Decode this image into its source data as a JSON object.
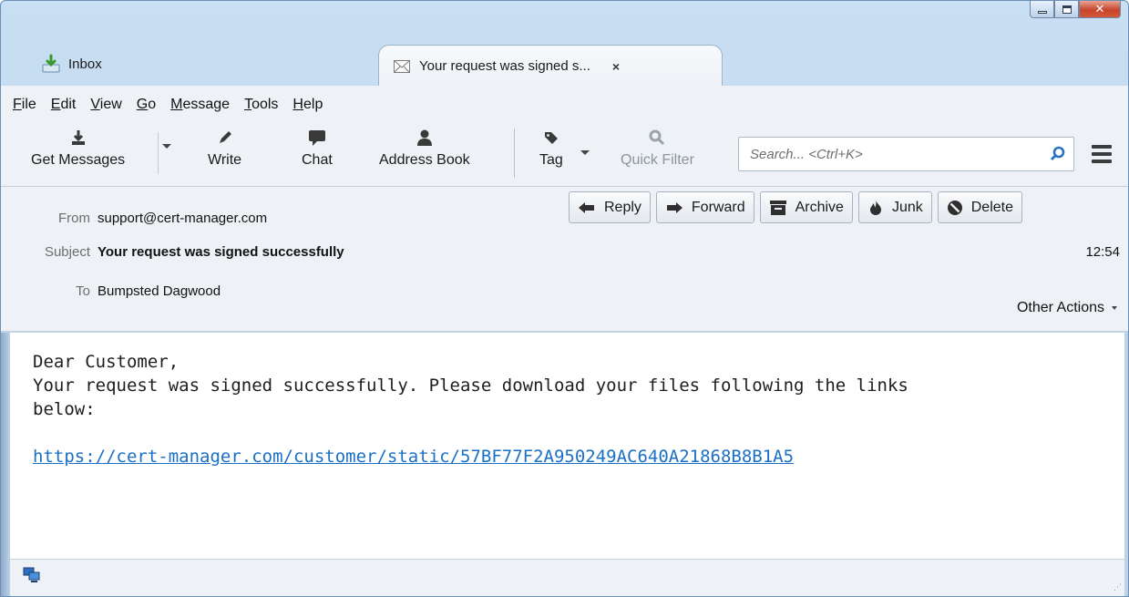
{
  "tabs": [
    {
      "label": "Inbox",
      "icon": "inbox-download-icon",
      "active": false
    },
    {
      "label": "Your request was signed s...",
      "icon": "envelope-icon",
      "active": true,
      "close": "×"
    }
  ],
  "menu": [
    {
      "accel": "F",
      "rest": "ile"
    },
    {
      "accel": "E",
      "rest": "dit"
    },
    {
      "accel": "V",
      "rest": "iew"
    },
    {
      "accel": "G",
      "rest": "o"
    },
    {
      "accel": "M",
      "rest": "essage"
    },
    {
      "accel": "T",
      "rest": "ools"
    },
    {
      "accel": "H",
      "rest": "elp"
    }
  ],
  "toolbar": {
    "get_messages": "Get Messages",
    "write": "Write",
    "chat": "Chat",
    "address_book": "Address Book",
    "tag": "Tag",
    "quick_filter": "Quick Filter",
    "search_placeholder": "Search... <Ctrl+K>"
  },
  "header": {
    "from_label": "From",
    "from_value": "support@cert-manager.com",
    "subject_label": "Subject",
    "subject_value": "Your request was signed successfully",
    "to_label": "To",
    "to_value": "Bumpsted Dagwood",
    "time": "12:54",
    "other_actions": "Other Actions",
    "buttons": {
      "reply": "Reply",
      "forward": "Forward",
      "archive": "Archive",
      "junk": "Junk",
      "delete": "Delete"
    }
  },
  "body": {
    "greeting": "Dear Customer,",
    "line1": "Your request was signed successfully. Please download your files following the links",
    "line2": "below:",
    "link": "https://cert-manager.com/customer/static/57BF77F2A950249AC640A21868B8B1A5"
  },
  "colors": {
    "link": "#1a6fc7",
    "chrome": "#eef2f6",
    "titlebar": "#bcd5ee",
    "close_button": "#c7452b"
  }
}
